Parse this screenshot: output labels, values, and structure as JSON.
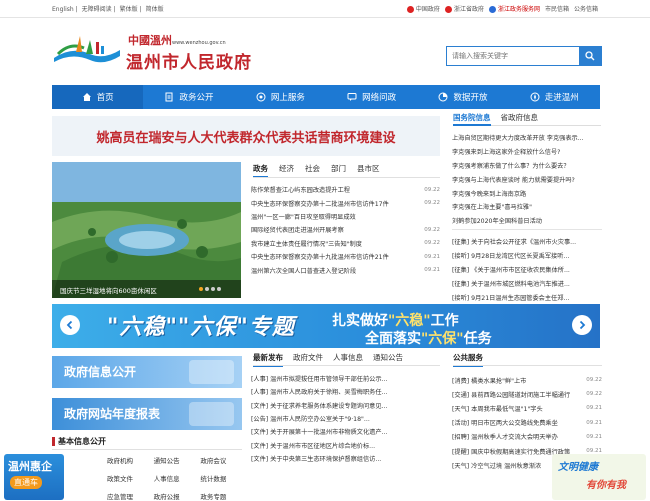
{
  "topbar": {
    "left_links": [
      "English",
      "|",
      "无障碍阅读",
      "|",
      "繁体版",
      "|",
      "简体版"
    ],
    "right_links": [
      {
        "label": "中国政府",
        "style": "normal"
      },
      {
        "label": "浙江省政府",
        "style": "normal"
      },
      {
        "label": "浙江政务服务网",
        "style": "red"
      },
      {
        "label": "市民信箱",
        "style": "normal"
      },
      {
        "label": "公务信箱",
        "style": "normal"
      }
    ]
  },
  "header": {
    "logo_cn": "中國溫州",
    "logo_url": "www.wenzhou.gov.cn",
    "title": "温州市人民政府",
    "search_placeholder": "请输入搜索关键字"
  },
  "nav": [
    {
      "label": "首页",
      "icon": "home-icon"
    },
    {
      "label": "政务公开",
      "icon": "document-icon"
    },
    {
      "label": "网上服务",
      "icon": "service-icon"
    },
    {
      "label": "网络问政",
      "icon": "chat-icon"
    },
    {
      "label": "数据开放",
      "icon": "data-icon"
    },
    {
      "label": "走进温州",
      "icon": "compass-icon"
    }
  ],
  "headline": "姚高员在瑞安与人大代表群众代表共话营商环境建设",
  "photo_caption": "国庆节三垟湿地将向600亩休闲区",
  "news_tabs": [
    "政务",
    "经济",
    "社会",
    "部门",
    "县市区"
  ],
  "news": [
    {
      "title": "陈作荣督查江心屿东园改造提升工程",
      "date": "09.22"
    },
    {
      "title": "中央生态环保督察交办第十二批温州市信访件17件",
      "date": "09.22"
    },
    {
      "title": "温州\"一区一廊\"百日攻坚取得明显成效",
      "date": ""
    },
    {
      "title": "国际经贸代表团走进温州开展考察",
      "date": "09.22"
    },
    {
      "title": "我市建立主体责任履行情况\"三告知\"制度",
      "date": "09.22"
    },
    {
      "title": "中央生态环保督察交办第十九批温州市信访件21件",
      "date": "09.21"
    },
    {
      "title": "温州第六次全国人口普查进入登记阶段",
      "date": "09.21"
    }
  ],
  "state_info": {
    "tabs": [
      "国务院信息",
      "省政府信息"
    ],
    "items": [
      "上海自贸区期待更大力度改革开放 李克强表示...",
      "李克强来到上海这家外企释放什么信号?",
      "李克强考察浦东做了什么事？为什么要去？",
      "李克强与上海代表座谈时 能力就需要提升吗?",
      "李克强今晚来到上海南京路",
      "李克强在上海主要\"喜马拉雅\"",
      "刘鹤参加2020年全国科普日活动"
    ],
    "items2": [
      "[征集] 关于向社会公开征求《温州市火灾事...",
      "[接听] 9月28日龙湾区代区长夏禹军接听...",
      "[征集] 《关于温州市市区征收农民集体所...",
      "[征集] 关于温州市城区燃料电池汽车推进...",
      "[接听] 9月21日温州生态园管委会主任郑..."
    ]
  },
  "big_banner": {
    "title_left": "\"六稳\"\"六保\"专题",
    "line1_pre": "扎实做好",
    "line1_hl": "\"六稳\"",
    "line1_post": "工作",
    "line2_pre": "全面落实",
    "line2_hl": "\"六保\"",
    "line2_post": "任务"
  },
  "blocks": [
    "政府信息公开",
    "政府网站年度报表"
  ],
  "basic_info": {
    "title": "基本信息公开",
    "links": [
      "政府机构",
      "通知公告",
      "政府会议",
      "政策文件",
      "人事信息",
      "统计数据",
      "应急管理",
      "政府公报",
      "政务专题"
    ]
  },
  "release_tabs": [
    "最新发布",
    "政府文件",
    "人事信息",
    "通知公告"
  ],
  "release": [
    "[人事] 温州市拟提拔任用市管领导干部任前公示...",
    "[人事] 温州市人民政府关于徐翔、吴雪梅职务任...",
    "[文件] 关于征求养老服务体系建设专题询问意见...",
    "[公告] 温州市人民防空办公室关于\"9·18\"...",
    "[文件] 关于开展第十一批温州市非物质文化遗产...",
    "[文件] 关于温州市市区征地区片综合地价标...",
    "[文件] 关于中央第三生态环境保护督察组信访..."
  ],
  "public_services": {
    "title": "公共服务",
    "items": [
      {
        "title": "[消费] 橘类水果抢\"鲜\"上市",
        "date": "09.22"
      },
      {
        "title": "[交通] 县前西路公园隧道封闭施工半幅通行",
        "date": "09.22"
      },
      {
        "title": "[天气] 本周我市最低气温\"1\"字头",
        "date": "09.21"
      },
      {
        "title": "[活动] 明日市区两大公交路线免费乘坐",
        "date": "09.21"
      },
      {
        "title": "[招聘] 温州秋季人才交流大会明天举办",
        "date": "09.21"
      },
      {
        "title": "[提醒] 国庆中秋假期高速实行免费通行政策",
        "date": "09.21"
      },
      {
        "title": "[天气] 冷空气过境 温州秋意渐浓",
        "date": ""
      }
    ]
  },
  "float_left": {
    "t1": "温州惠企",
    "t2": "直通车"
  },
  "float_right": {
    "t1": "文明健康",
    "t2": "有你有我"
  },
  "colors": {
    "brand_red": "#c1272d",
    "nav_blue": "#1d79d3"
  }
}
